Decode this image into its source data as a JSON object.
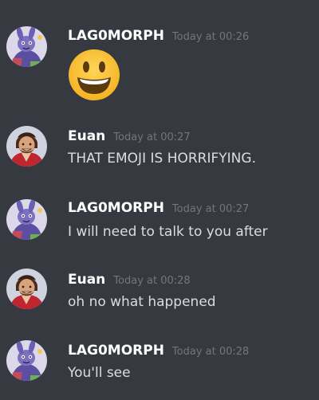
{
  "colors": {
    "background": "#36393f",
    "username": "#ffffff",
    "timestamp": "#72767d",
    "text": "#dcddde"
  },
  "messages": [
    {
      "author": "LAG0MORPH",
      "timestamp": "Today at 00:26",
      "emoji": "smiley-emoji",
      "avatar": "lagomorph-avatar"
    },
    {
      "author": "Euan",
      "timestamp": "Today at 00:27",
      "text": "THAT EMOJI IS HORRIFYING.",
      "avatar": "euan-avatar"
    },
    {
      "author": "LAG0MORPH",
      "timestamp": "Today at 00:27",
      "text": "I will need to talk to you after",
      "avatar": "lagomorph-avatar"
    },
    {
      "author": "Euan",
      "timestamp": "Today at 00:28",
      "text": "oh no what happened",
      "avatar": "euan-avatar"
    },
    {
      "author": "LAG0MORPH",
      "timestamp": "Today at 00:28",
      "text": "You'll see",
      "avatar": "lagomorph-avatar"
    }
  ]
}
